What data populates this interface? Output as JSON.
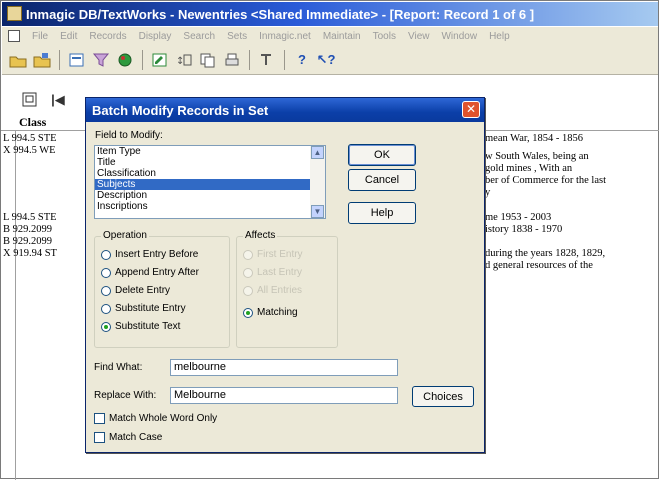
{
  "window": {
    "title": "Inmagic DB/TextWorks - Newentries <Shared Immediate> - [Report: Record 1 of 6 ]",
    "menu": [
      "File",
      "Edit",
      "Records",
      "Display",
      "Search",
      "Sets",
      "Inmagic.net",
      "Maintain",
      "Tools",
      "View",
      "Window",
      "Help"
    ]
  },
  "report": {
    "column_header": "Class",
    "left_rows": [
      "L 994.5 STE",
      "X 994.5 WE",
      "L 994.5 STE",
      "B 929.2099",
      "B 929.2099",
      "X 919.94 ST"
    ],
    "right_rows": [
      "mean War, 1854 - 1856",
      "w South Wales, being an",
      "gold mines , With an",
      "ber of Commerce for the last",
      "y",
      "me 1953 - 2003",
      "istory 1838 - 1970",
      "during the years 1828, 1829,",
      "d general resources of the"
    ]
  },
  "dialog": {
    "title": "Batch Modify Records in Set",
    "field_label": "Field to Modify:",
    "fields": [
      "Item Type",
      "Title",
      "Classification",
      "Subjects",
      "Description",
      "Inscriptions"
    ],
    "selected_field": "Subjects",
    "buttons": {
      "ok": "OK",
      "cancel": "Cancel",
      "help": "Help",
      "choices": "Choices"
    },
    "operation": {
      "legend": "Operation",
      "options": [
        "Insert Entry Before",
        "Append Entry After",
        "Delete Entry",
        "Substitute Entry",
        "Substitute Text"
      ],
      "selected": "Substitute Text"
    },
    "affects": {
      "legend": "Affects",
      "options": [
        "First Entry",
        "Last Entry",
        "All Entries",
        "Matching"
      ],
      "selected": "Matching"
    },
    "find_label": "Find What:",
    "find_value": "melbourne",
    "replace_label": "Replace With:",
    "replace_value": "Melbourne",
    "match_whole_word": "Match Whole Word Only",
    "match_case": "Match Case"
  },
  "colors": {
    "title_bar": "#0a246a",
    "dialog_face": "#ece9d8",
    "selection": "#316ac5",
    "close_button": "#e0532d"
  }
}
